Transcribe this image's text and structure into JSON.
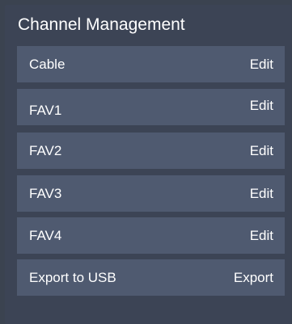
{
  "title": "Channel Management",
  "items": [
    {
      "label": "Cable",
      "action": "Edit"
    },
    {
      "label": "FAV1",
      "action": "Edit"
    },
    {
      "label": "FAV2",
      "action": "Edit"
    },
    {
      "label": "FAV3",
      "action": "Edit"
    },
    {
      "label": "FAV4",
      "action": "Edit"
    },
    {
      "label": "Export to USB",
      "action": "Export"
    }
  ]
}
